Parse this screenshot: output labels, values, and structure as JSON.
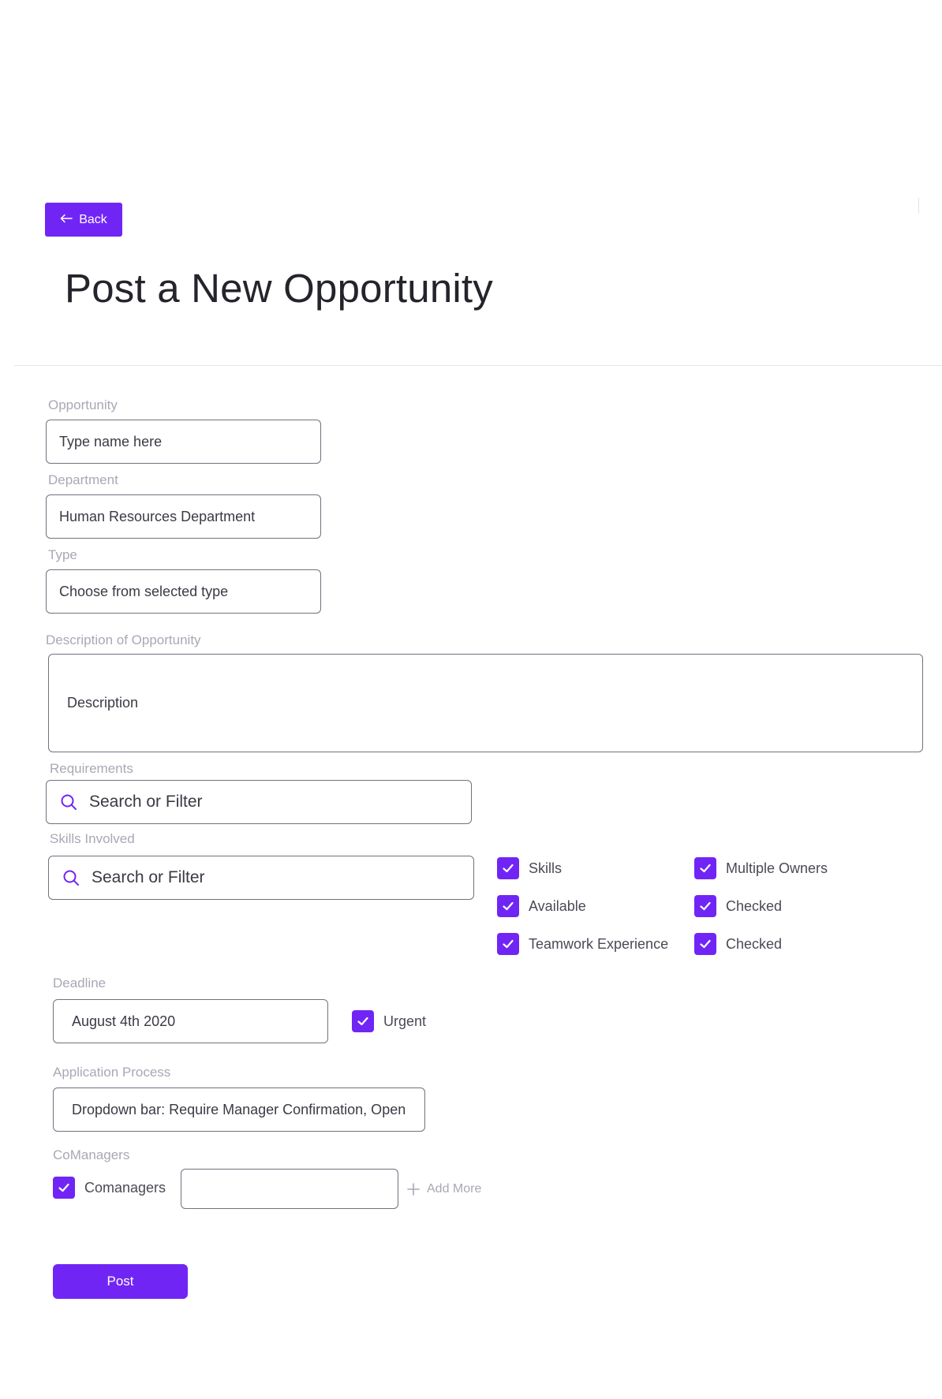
{
  "header": {
    "back_label": "Back",
    "page_title": "Post a New Opportunity"
  },
  "form": {
    "opportunity": {
      "label": "Opportunity",
      "placeholder": "Type name here"
    },
    "department": {
      "label": "Department",
      "value": "Human Resources Department"
    },
    "type": {
      "label": "Type",
      "placeholder": "Choose from selected type"
    },
    "description": {
      "label": "Description of Opportunity",
      "placeholder": "Description"
    },
    "requirements": {
      "label": "Requirements",
      "placeholder": "Search or Filter"
    },
    "skills": {
      "label": "Skills Involved",
      "placeholder": "Search or Filter",
      "options": [
        {
          "label": "Skills",
          "checked": true
        },
        {
          "label": "Multiple Owners",
          "checked": true
        },
        {
          "label": "Available",
          "checked": true
        },
        {
          "label": "Checked",
          "checked": true
        },
        {
          "label": "Teamwork Experience",
          "checked": true
        },
        {
          "label": "Checked",
          "checked": true
        }
      ]
    },
    "deadline": {
      "label": "Deadline",
      "value": "August 4th 2020",
      "urgent_label": "Urgent",
      "urgent_checked": true
    },
    "application_process": {
      "label": "Application Process",
      "value": "Dropdown bar: Require Manager Confirmation, Open"
    },
    "comanagers": {
      "label": "CoManagers",
      "checkbox_label": "Comanagers",
      "checked": true,
      "input_value": "",
      "add_more_label": "Add More"
    },
    "post_label": "Post"
  },
  "colors": {
    "accent": "#7125f5",
    "label": "#a7a9b4",
    "border": "#70727e"
  }
}
